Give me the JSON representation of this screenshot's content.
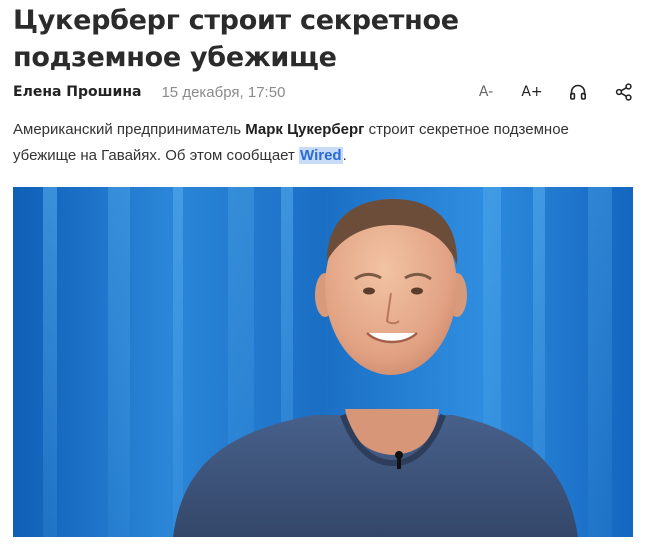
{
  "article": {
    "title": "Цукерберг строит секретное подземное убежище",
    "author": "Елена Прошина",
    "date": "15 декабря, 17:50",
    "lead": {
      "part1": "Американский предприниматель ",
      "person": "Марк Цукерберг",
      "part2": " строит секретное подземное убежище на Гавайях. Об этом сообщает ",
      "source_link": "Wired",
      "part3": "."
    }
  },
  "toolbar": {
    "font_decrease_label": "A-",
    "font_increase_label": "A+",
    "listen_icon": "headphones-icon",
    "share_icon": "share-icon"
  },
  "colors": {
    "link": "#2b6bd6",
    "link_highlight": "#c9dcf7",
    "photo_background": "#1f74c8",
    "shirt": "#3b4f73"
  }
}
